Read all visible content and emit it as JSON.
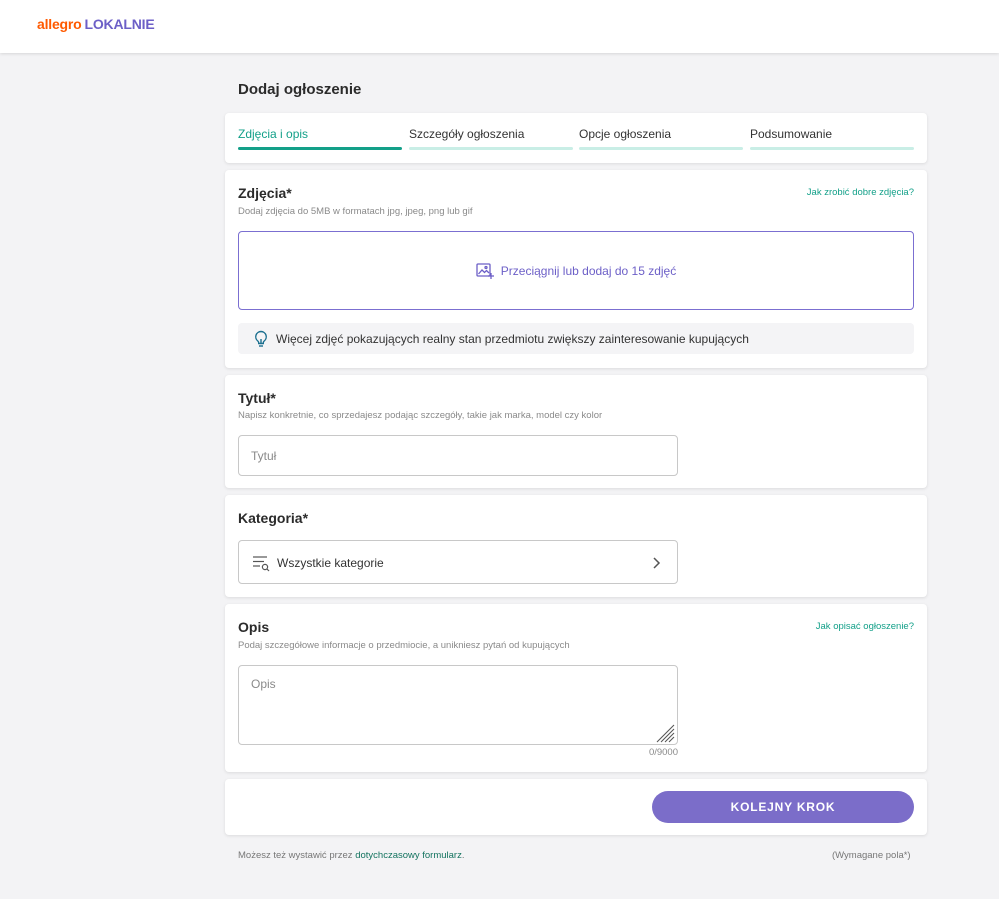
{
  "header": {
    "logo_part1": "allegro",
    "logo_part2": "LOKALNIE"
  },
  "page_title": "Dodaj ogłoszenie",
  "steps": [
    {
      "label": "Zdjęcia i opis",
      "active": true
    },
    {
      "label": "Szczegóły ogłoszenia",
      "active": false
    },
    {
      "label": "Opcje ogłoszenia",
      "active": false
    },
    {
      "label": "Podsumowanie",
      "active": false
    }
  ],
  "photos": {
    "title": "Zdjęcia*",
    "hint": "Dodaj zdjęcia do 5MB w formatach jpg, jpeg, png lub gif",
    "help_link": "Jak zrobić dobre zdjęcia?",
    "dropzone_text": "Przeciągnij lub dodaj do 15 zdjęć",
    "tip": "Więcej zdjęć pokazujących realny stan przedmiotu zwiększy zainteresowanie kupujących"
  },
  "title_section": {
    "title": "Tytuł*",
    "hint": "Napisz konkretnie, co sprzedajesz podając szczegóły, takie jak marka, model czy kolor",
    "input_placeholder": "Tytuł",
    "input_value": ""
  },
  "category": {
    "title": "Kategoria*",
    "selected": "Wszystkie kategorie"
  },
  "description": {
    "title": "Opis",
    "help_link": "Jak opisać ogłoszenie?",
    "hint": "Podaj szczegółowe informacje o przedmiocie, a unikniesz pytań od kupujących",
    "placeholder": "Opis",
    "value": "",
    "counter": "0/9000"
  },
  "next_button": "KOLEJNY KROK",
  "footer": {
    "prefix": "Możesz też wystawić przez",
    "link": "dotychczasowy formularz",
    "suffix": ".",
    "required_note": "(Wymagane pola*)"
  },
  "colors": {
    "accent_teal": "#13a089",
    "accent_purple": "#7b6dc9",
    "brand_orange": "#ff5a00"
  }
}
